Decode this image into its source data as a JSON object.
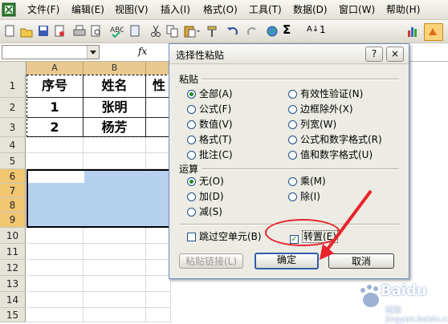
{
  "menu": [
    "文件(F)",
    "编辑(E)",
    "视图(V)",
    "插入(I)",
    "格式(O)",
    "工具(T)",
    "数据(D)",
    "窗口(W)",
    "帮助(H)"
  ],
  "toolbar": {
    "sigma": "Σ",
    "sort": "A↓",
    "zoom_fragment": "1"
  },
  "formula_bar": {
    "fx": "fx"
  },
  "columns": [
    "A",
    "B"
  ],
  "rows": [
    "1",
    "2",
    "3",
    "4",
    "5",
    "6",
    "7",
    "8",
    "9",
    "10",
    "11",
    "12",
    "13",
    "14",
    "15"
  ],
  "table": {
    "header": [
      "序号",
      "姓名",
      "性"
    ],
    "rows": [
      [
        "1",
        "张明",
        ""
      ],
      [
        "2",
        "杨芳",
        ""
      ]
    ]
  },
  "dialog": {
    "title": "选择性粘贴",
    "help": "?",
    "close": "×",
    "paste_group": "粘贴",
    "paste_options_left": [
      "全部(A)",
      "公式(F)",
      "数值(V)",
      "格式(T)",
      "批注(C)"
    ],
    "paste_options_right": [
      "有效性验证(N)",
      "边框除外(X)",
      "列宽(W)",
      "公式和数字格式(R)",
      "值和数字格式(U)"
    ],
    "operation_group": "运算",
    "operation_left": [
      "无(O)",
      "加(D)",
      "减(S)"
    ],
    "operation_right": [
      "乘(M)",
      "除(I)"
    ],
    "skip_blanks": "跳过空单元(B)",
    "transpose": "转置(E)",
    "paste_link": "粘贴链接(L)",
    "ok": "确定",
    "cancel": "取消",
    "selected_paste": "全部(A)",
    "selected_operation": "无(O)",
    "skip_blanks_checked": false,
    "transpose_checked": true
  },
  "watermark": {
    "brand": "Baidu",
    "sub": "经验 jingyan.baidu.com"
  },
  "colors": {
    "highlight": "#e8232a",
    "selection": "#b6d1ee",
    "accent": "#2f5fa8"
  }
}
